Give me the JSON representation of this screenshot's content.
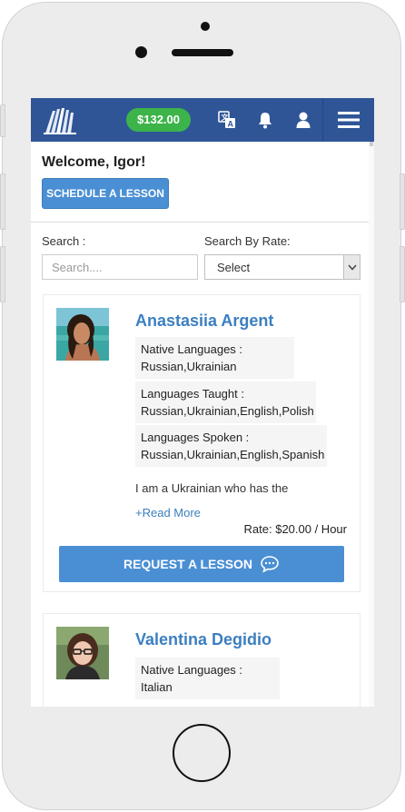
{
  "header": {
    "balance": "$132.00",
    "icons": [
      "logo-icon",
      "translate-icon",
      "bell-icon",
      "user-icon",
      "menu-icon"
    ]
  },
  "welcome": "Welcome, Igor!",
  "schedule_button": "SCHEDULE A LESSON",
  "filters": {
    "search_label": "Search :",
    "search_placeholder": "Search....",
    "search_value": "",
    "rate_label": "Search By Rate:",
    "rate_selected": "Select"
  },
  "tutors": [
    {
      "name": "Anastasiia Argent",
      "native_label": "Native Languages :",
      "native": "Russian,Ukrainian",
      "taught_label": "Languages Taught :",
      "taught": "Russian,Ukrainian,English,Polish",
      "spoken_label": "Languages Spoken :",
      "spoken": "Russian,Ukrainian,English,Spanish",
      "bio": "I am a Ukrainian who has the",
      "read_more": "+Read More",
      "rate": "Rate: $20.00 / Hour",
      "request_button": "REQUEST A LESSON"
    },
    {
      "name": "Valentina Degidio",
      "native_line": "Native Languages : Italian"
    }
  ],
  "colors": {
    "header_bg": "#2f5597",
    "balance_bg": "#3cb44a",
    "primary_button": "#4a8fd4",
    "name_text": "#3c7fc0"
  }
}
